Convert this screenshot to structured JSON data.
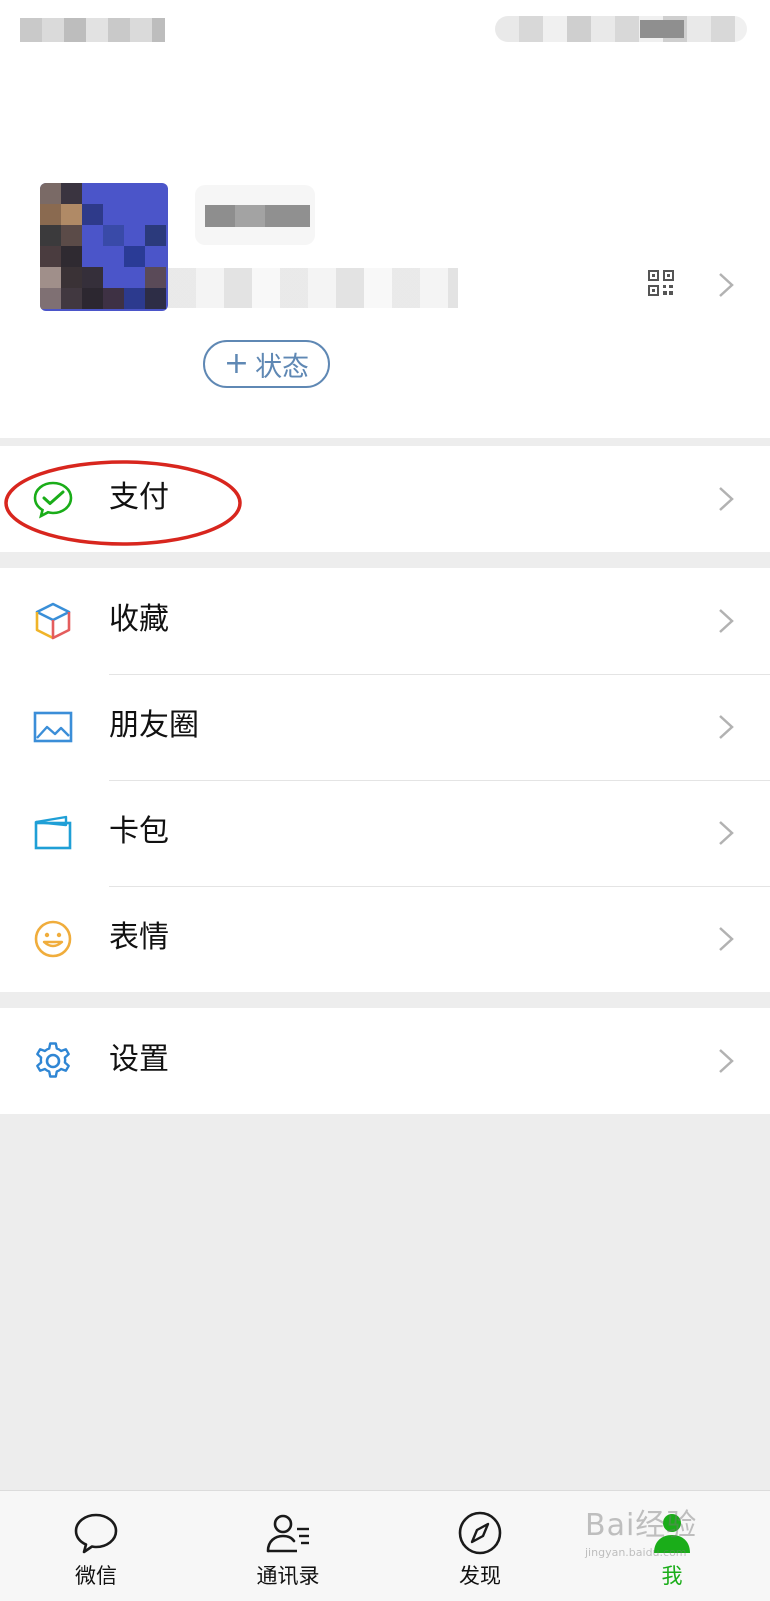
{
  "profile": {
    "status_button_label": "状态",
    "qr_icon": "qr-code-icon",
    "chevron_icon": "chevron-right-icon"
  },
  "menu": {
    "pay": {
      "label": "支付",
      "icon": "wechat-pay-icon",
      "color": "#1aad19"
    },
    "favorites": {
      "label": "收藏",
      "icon": "cube-icon"
    },
    "moments": {
      "label": "朋友圈",
      "icon": "photo-icon",
      "color": "#3b8ed8"
    },
    "cards": {
      "label": "卡包",
      "icon": "card-wallet-icon",
      "color": "#1f9fd6"
    },
    "stickers": {
      "label": "表情",
      "icon": "smiley-icon",
      "color": "#f0ad3c"
    },
    "settings": {
      "label": "设置",
      "icon": "gear-icon",
      "color": "#2f86d4"
    }
  },
  "tabbar": {
    "tabs": [
      {
        "label": "微信",
        "icon": "chat-bubble-icon"
      },
      {
        "label": "通讯录",
        "icon": "contacts-icon"
      },
      {
        "label": "发现",
        "icon": "compass-icon"
      },
      {
        "label": "我",
        "icon": "me-person-icon",
        "active": true,
        "color": "#1aad19"
      }
    ]
  },
  "watermark": {
    "brand": "Bai经验",
    "url": "jingyan.baidu.com"
  },
  "colors": {
    "highlight_circle": "#d8261e",
    "background": "#ededed",
    "link_blue": "#5f88b4"
  }
}
